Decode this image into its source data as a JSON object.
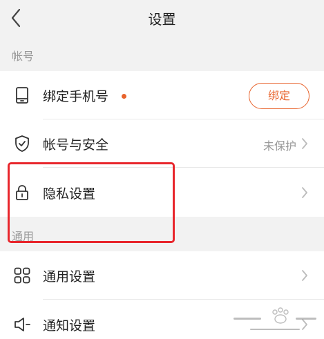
{
  "header": {
    "title": "设置",
    "back_icon": "chevron-left-icon"
  },
  "sections": {
    "account": "帐号",
    "general": "通用"
  },
  "rows": {
    "phone": {
      "label": "绑定手机号",
      "icon": "phone-icon",
      "has_badge_dot": true,
      "button_label": "绑定"
    },
    "security": {
      "label": "帐号与安全",
      "icon": "shield-check-icon",
      "status": "未保护"
    },
    "privacy": {
      "label": "隐私设置",
      "icon": "lock-icon"
    },
    "general": {
      "label": "通用设置",
      "icon": "grid-icon"
    },
    "notify": {
      "label": "通知设置",
      "icon": "speaker-icon"
    }
  },
  "annotation": {
    "highlight_color": "#e8262c",
    "highlight_target": "privacy"
  },
  "colors": {
    "accent": "#e8632c",
    "background": "#f2f2f2",
    "card": "#ffffff",
    "muted_text": "#999999"
  }
}
